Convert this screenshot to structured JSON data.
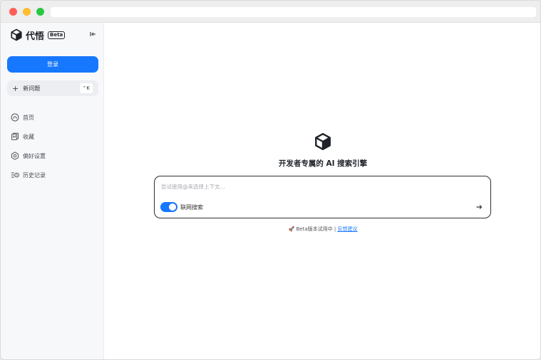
{
  "brand": {
    "name": "代悟",
    "badge": "Beta"
  },
  "sidebar": {
    "login_label": "登录",
    "new_question_label": "新问题",
    "new_question_shortcut": "⌃K",
    "items": [
      {
        "label": "首页",
        "icon": "home-icon"
      },
      {
        "label": "收藏",
        "icon": "bookmark-icon"
      },
      {
        "label": "偏好设置",
        "icon": "settings-icon"
      },
      {
        "label": "历史记录",
        "icon": "history-icon"
      }
    ]
  },
  "main": {
    "title": "开发者专属的 AI 搜索引擎",
    "search": {
      "placeholder": "尝试使用@来选择上下文...",
      "value": "",
      "web_search_label": "联网搜索",
      "web_search_enabled": true
    },
    "footer": {
      "icon": "🚀",
      "text": "Beta版本试用中 |",
      "link": "反馈建议"
    }
  },
  "colors": {
    "accent": "#1677ff",
    "sidebar_bg": "#f7f8fa"
  }
}
